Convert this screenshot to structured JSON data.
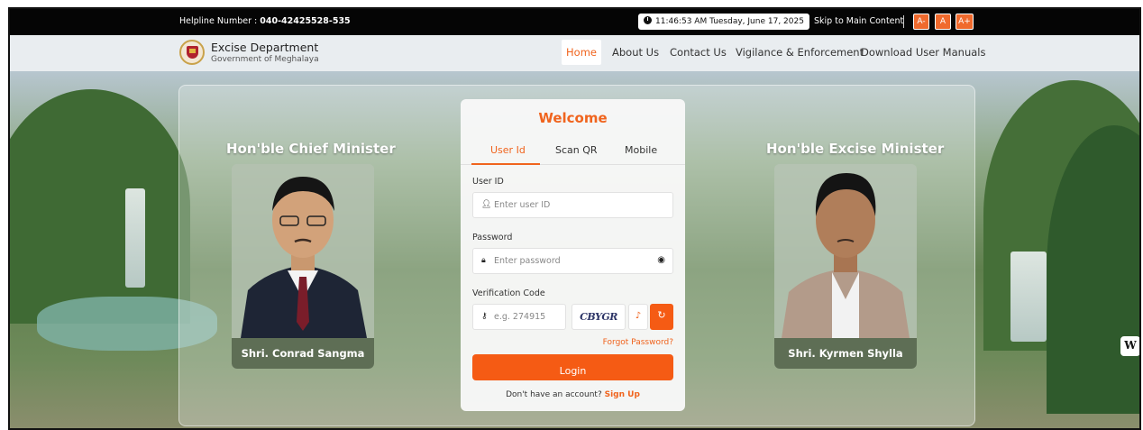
{
  "topbar": {
    "helpline_label": "Helpline Number : ",
    "helpline_number": "040-42425528-535",
    "clock": "11:46:53 AM  Tuesday, June 17, 2025",
    "skip": "Skip to Main Content",
    "font_small": "A-",
    "font_normal": "A",
    "font_large": "A+"
  },
  "header": {
    "dept_name": "Excise Department",
    "gov_name": "Government of Meghalaya",
    "nav": [
      "Home",
      "About Us",
      "Contact Us",
      "Vigilance & Enforcement",
      "Download User Manuals"
    ]
  },
  "ministers": {
    "left_title": "Hon'ble Chief Minister",
    "left_name": "Shri. Conrad Sangma",
    "right_title": "Hon'ble Excise Minister",
    "right_name": "Shri. Kyrmen Shylla"
  },
  "login": {
    "welcome": "Welcome",
    "tabs": [
      "User Id",
      "Scan QR",
      "Mobile"
    ],
    "userid_label": "User ID",
    "userid_placeholder": "Enter user ID",
    "password_label": "Password",
    "password_placeholder": "Enter password",
    "verification_label": "Verification Code",
    "verification_placeholder": "e.g. 274915",
    "captcha_text": "CBYGR",
    "forgot": "Forgot Password?",
    "login_button": "Login",
    "no_account": "Don't have an account?",
    "signup": "Sign Up"
  },
  "widget_label": "W",
  "colors": {
    "accent": "#f0641e",
    "button": "#f55b14",
    "topbar": "#050505"
  },
  "icons": [
    "clock-icon",
    "user-icon",
    "lock-icon",
    "eye-slash-icon",
    "key-icon",
    "speaker-icon",
    "refresh-icon"
  ]
}
